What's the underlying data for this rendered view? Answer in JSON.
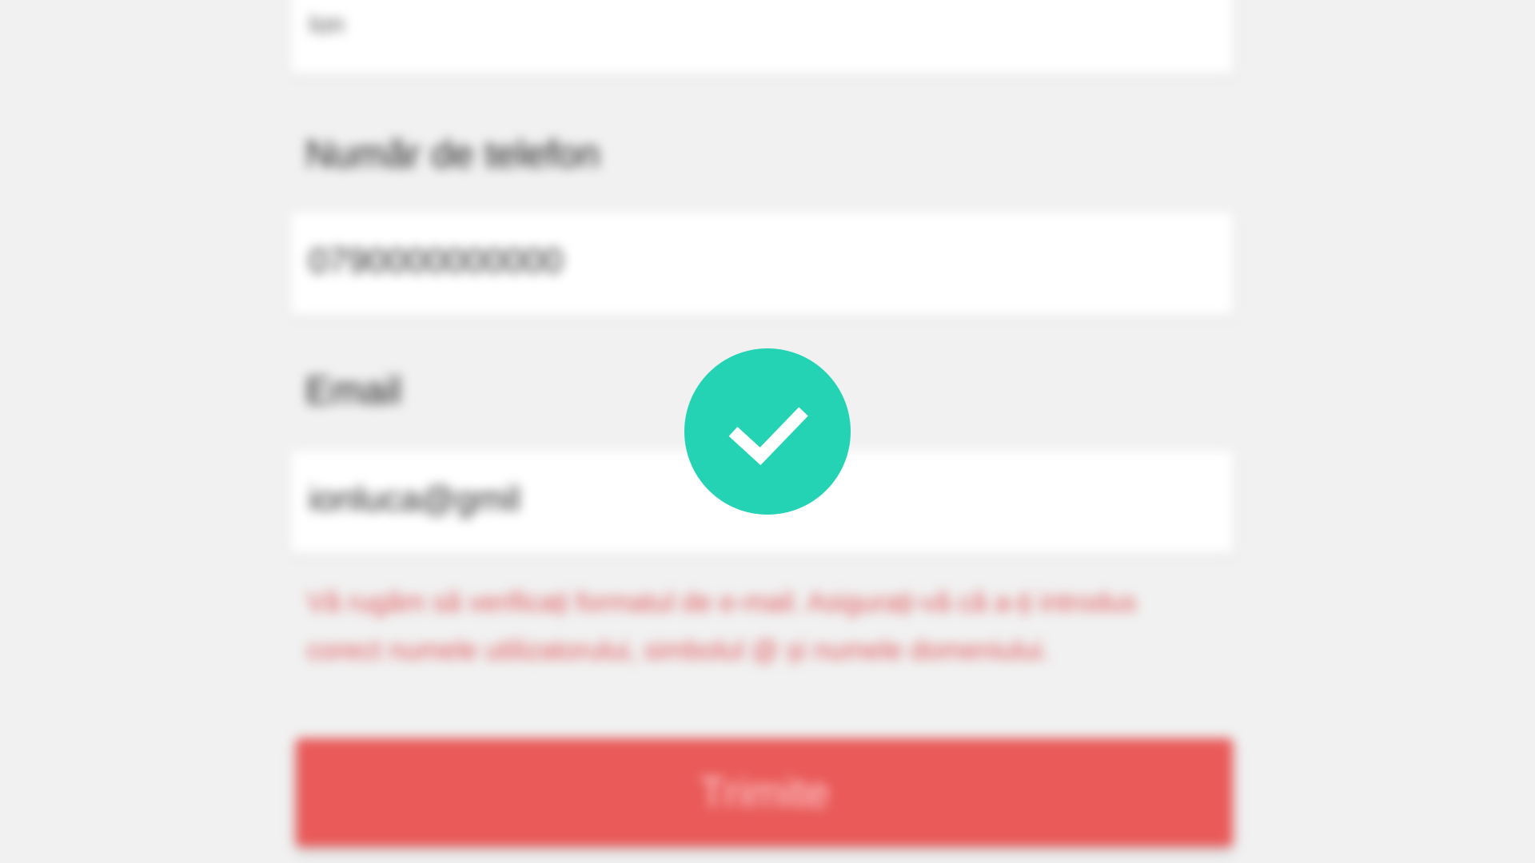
{
  "form": {
    "name_value": "Ion",
    "phone_label": "Număr de telefon",
    "phone_value": "0790000000000",
    "email_label": "Email",
    "email_value": "ionluca@gmil",
    "error_message": "Vă rugăm să verificați formatul de e-mail. Asigurați-vă că a-ți introdus corect numele utilizatorului, simbolul @ și numele domeniului.",
    "submit_label": "Trimite"
  },
  "overlay": {
    "icon": "check-icon",
    "badge_color": "#23d3b3",
    "check_color": "#ffffff"
  },
  "colors": {
    "background": "#f1f1f1",
    "error": "#e0575a",
    "button": "#e95a59"
  }
}
